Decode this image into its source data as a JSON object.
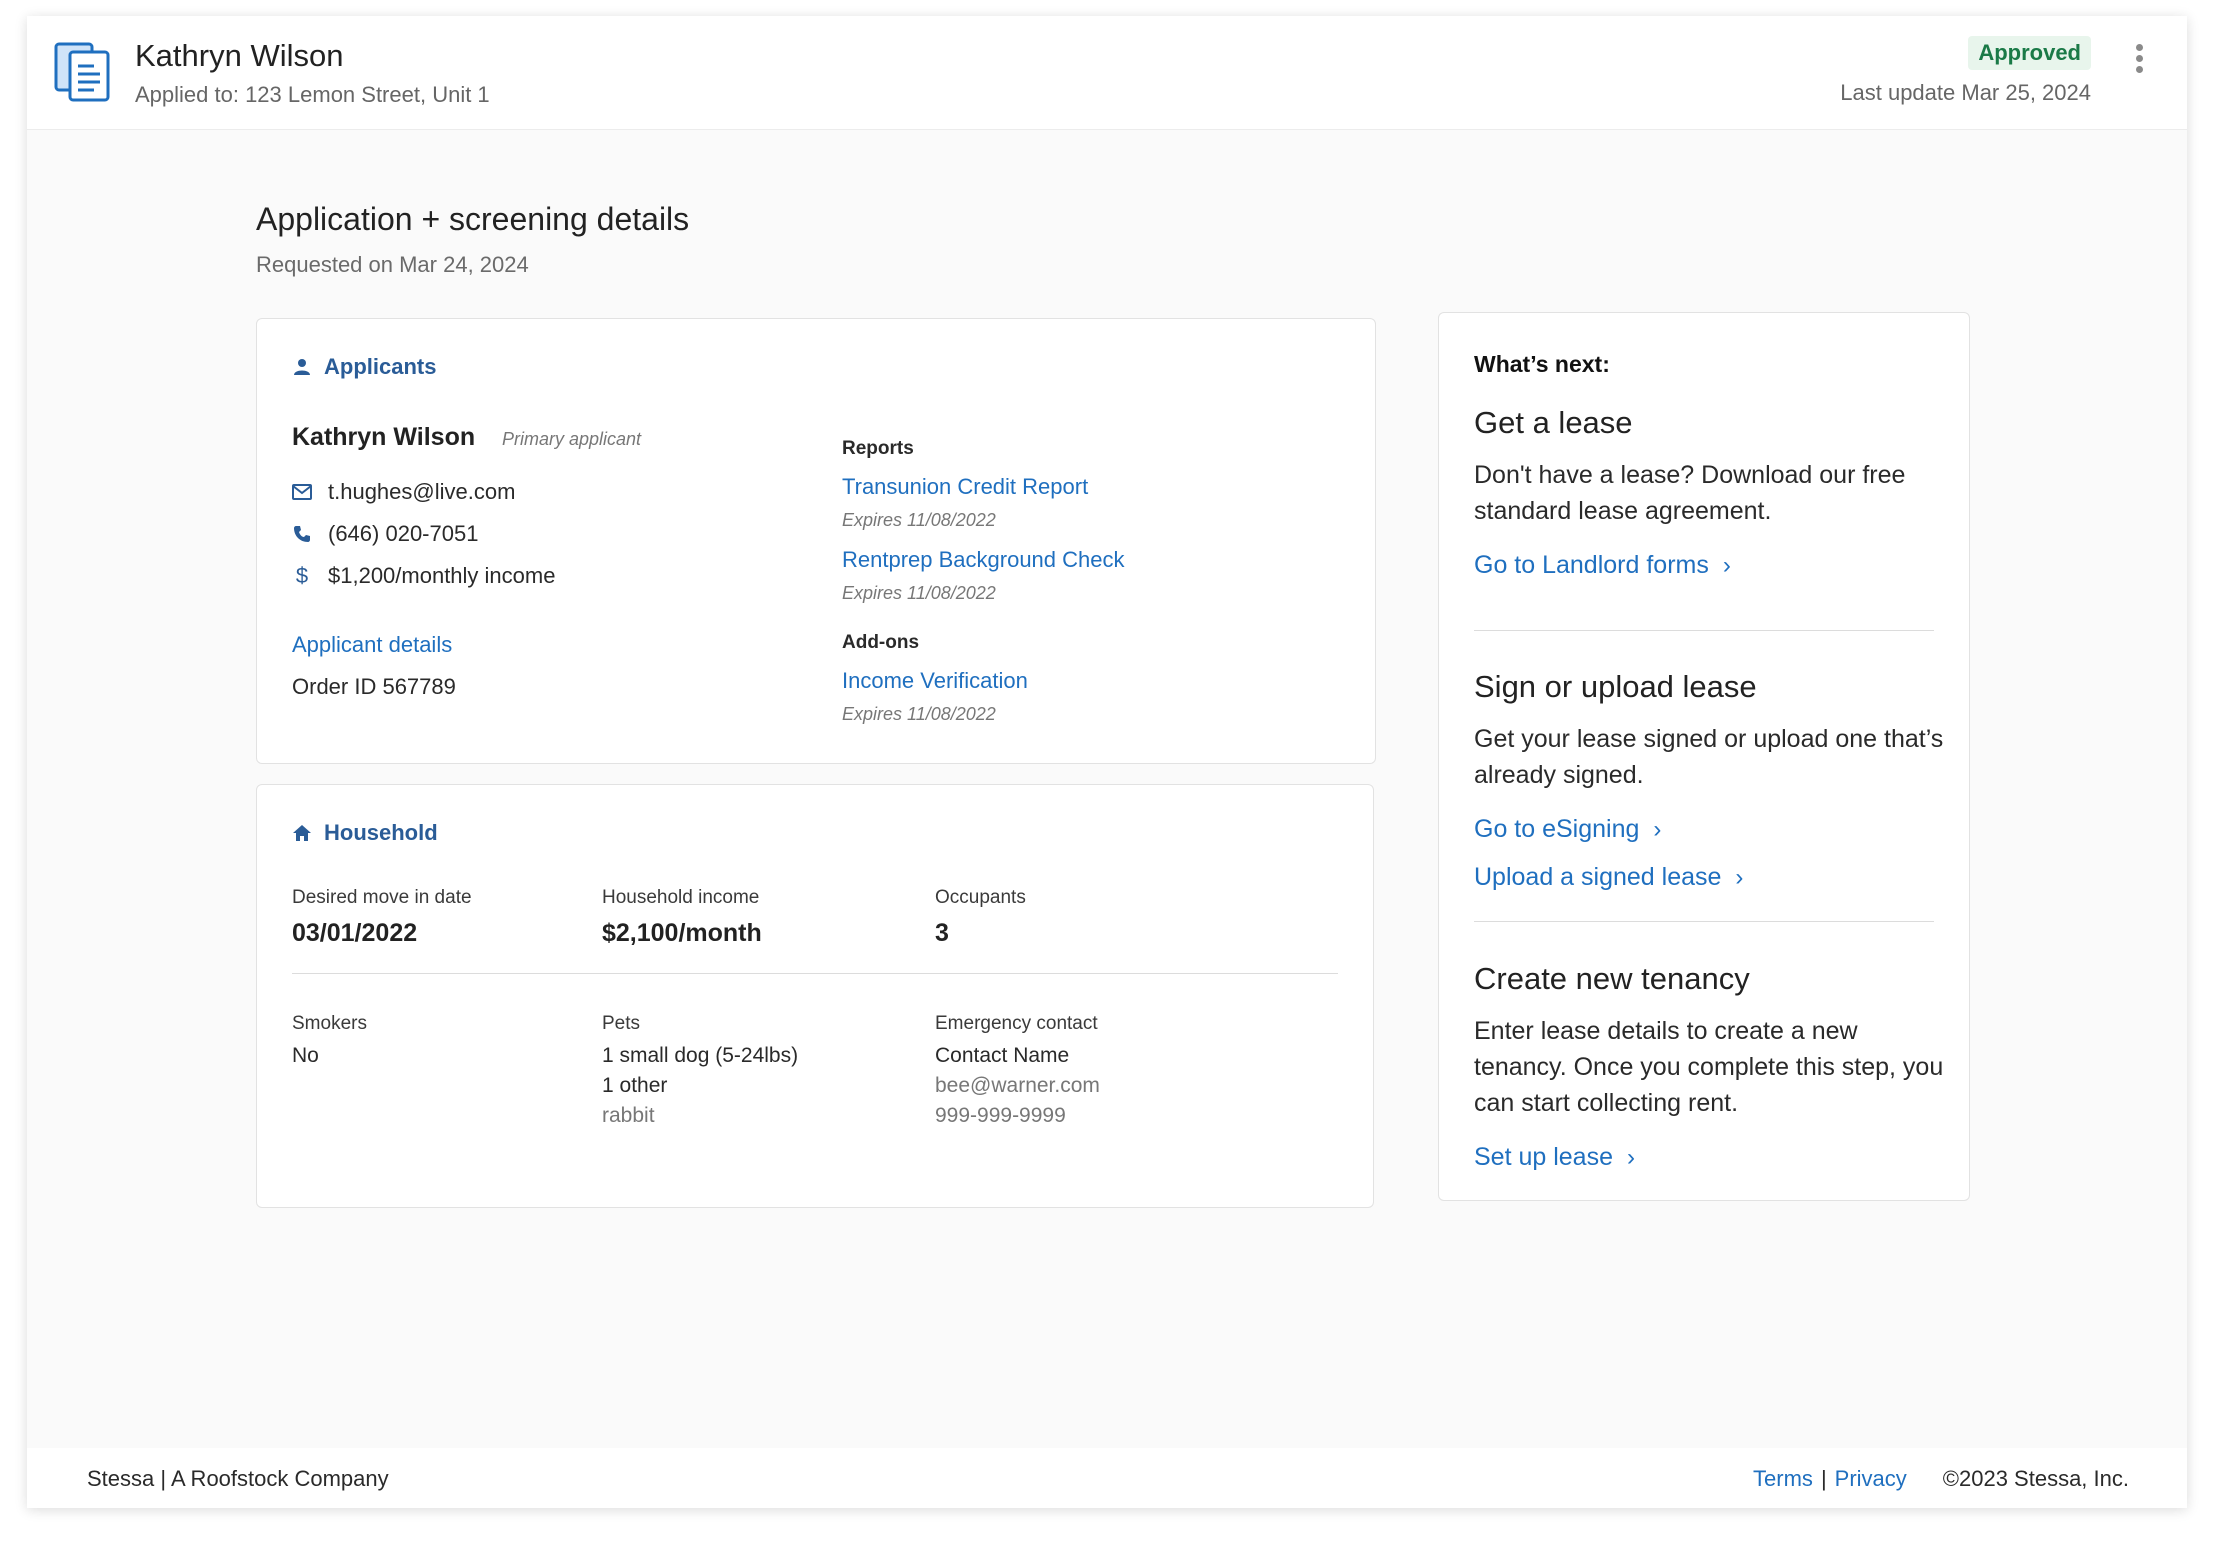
{
  "header": {
    "name": "Kathryn Wilson",
    "applied_to": "Applied to: 123 Lemon Street, Unit 1",
    "status": "Approved",
    "last_update": "Last update Mar 25, 2024",
    "icon": "document-icon"
  },
  "page": {
    "title": "Application + screening details",
    "requested": "Requested on Mar 24, 2024"
  },
  "applicants": {
    "section_label": "Applicants",
    "name": "Kathryn Wilson",
    "role": "Primary applicant",
    "email": "t.hughes@live.com",
    "phone": "(646) 020-7051",
    "income": "$1,200/monthly income",
    "details_link": "Applicant details",
    "order_id": "Order ID 567789",
    "reports_label": "Reports",
    "reports": [
      {
        "name": "Transunion Credit Report",
        "expires": "Expires 11/08/2022"
      },
      {
        "name": "Rentprep Background Check",
        "expires": "Expires 11/08/2022"
      }
    ],
    "addons_label": "Add-ons",
    "addons": [
      {
        "name": "Income Verification",
        "expires": "Expires 11/08/2022"
      }
    ]
  },
  "household": {
    "section_label": "Household",
    "move_in_label": "Desired move in date",
    "move_in": "03/01/2022",
    "income_label": "Household income",
    "income": "$2,100/month",
    "occupants_label": "Occupants",
    "occupants": "3",
    "smokers_label": "Smokers",
    "smokers": "No",
    "pets_label": "Pets",
    "pets_line1": "1 small dog (5-24lbs)",
    "pets_line2": "1 other",
    "pets_line3": "rabbit",
    "emergency_label": "Emergency contact",
    "emergency_name": "Contact Name",
    "emergency_email": "bee@warner.com",
    "emergency_phone": "999-999-9999"
  },
  "next": {
    "heading": "What’s next:",
    "lease_title": "Get a lease",
    "lease_body": "Don't have a lease? Download our free standard lease agreement.",
    "lease_link": "Go to Landlord forms",
    "sign_title": "Sign or upload lease",
    "sign_body": "Get your lease signed or upload one that’s already signed.",
    "sign_link1": "Go to eSigning",
    "sign_link2": "Upload a signed lease",
    "tenancy_title": "Create new tenancy",
    "tenancy_body": "Enter lease details to create a new tenancy. Once you complete this step, you can start collecting rent.",
    "tenancy_link": "Set up lease"
  },
  "footer": {
    "brand": "Stessa | A Roofstock Company",
    "terms": "Terms",
    "separator": "|",
    "privacy": "Privacy",
    "copyright": "©2023 Stessa, Inc."
  },
  "colors": {
    "accent": "#1f6fbf",
    "section_heading": "#2a5c97",
    "approved_text": "#1a7a47",
    "approved_bg": "#e8f5ec"
  }
}
